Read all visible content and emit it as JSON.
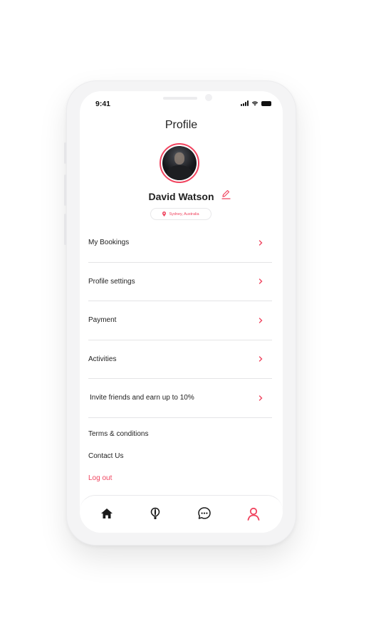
{
  "status_bar": {
    "time": "9:41"
  },
  "header": {
    "title": "Profile"
  },
  "profile": {
    "name": "David Watson",
    "location": "Sydney, Australia"
  },
  "menu": {
    "items": [
      {
        "label": "My Bookings"
      },
      {
        "label": "Profile settings"
      },
      {
        "label": "Payment"
      },
      {
        "label": "Activities"
      },
      {
        "label": "Invite friends and earn up to 10%"
      }
    ]
  },
  "links": {
    "terms": "Terms & conditions",
    "contact": "Contact Us",
    "logout": "Log out"
  },
  "tabbar": {
    "tabs": [
      {
        "icon": "home-icon",
        "active": false
      },
      {
        "icon": "balloon-icon",
        "active": false
      },
      {
        "icon": "chat-icon",
        "active": false
      },
      {
        "icon": "user-icon",
        "active": true
      }
    ]
  },
  "colors": {
    "accent": "#f0445f",
    "text": "#222222",
    "divider": "#e4e4e6"
  }
}
